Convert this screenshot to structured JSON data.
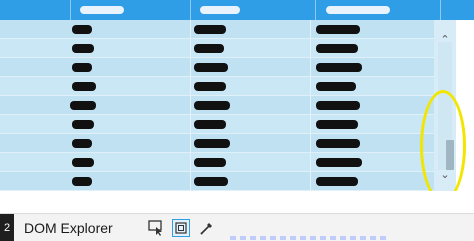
{
  "devtools": {
    "left_tab_label": "2",
    "title": "DOM Explorer",
    "tools": [
      {
        "name": "select-element",
        "icon": "pointer-select-icon",
        "active": false
      },
      {
        "name": "highlight-frame",
        "icon": "frame-highlight-icon",
        "active": true
      },
      {
        "name": "color-picker",
        "icon": "eyedropper-icon",
        "active": false
      }
    ]
  },
  "scrollbar": {
    "up_glyph": "⌃",
    "down_glyph": "⌄"
  },
  "colors": {
    "header": "#2f9ee6",
    "row_light": "#cae7f5",
    "row_dark": "#bfe1f2",
    "highlight": "#f2e600"
  }
}
